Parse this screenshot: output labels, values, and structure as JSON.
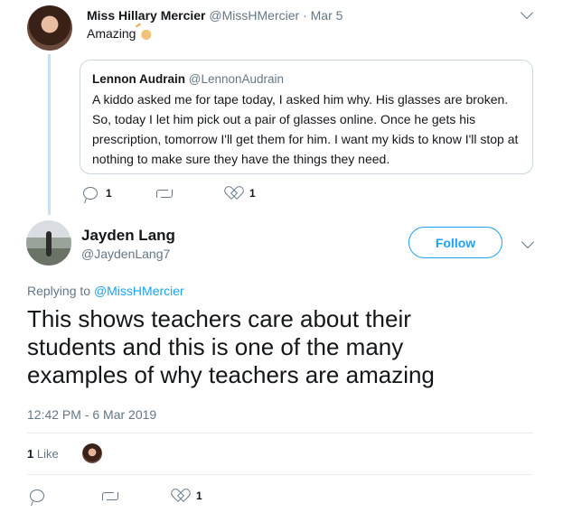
{
  "parent_tweet": {
    "name": "Miss Hillary Mercier",
    "handle": "@MissHMercier",
    "separator": "·",
    "date": "Mar 5",
    "text": "Amazing",
    "emoji_icon": "clapping-hands-icon",
    "quoted": {
      "name": "Lennon Audrain",
      "handle": "@LennonAudrain",
      "text": "A kiddo asked me for tape today, I asked him why. His glasses are broken. So, today I let him pick out a pair of glasses online. Once he gets his prescription, tomorrow I'll get them for him. I want my kids to know I'll stop at nothing to make sure they have the things they need."
    },
    "actions": {
      "reply_count": "1",
      "retweet_count": "",
      "like_count": "1"
    }
  },
  "main_tweet": {
    "name": "Jayden Lang",
    "handle": "@JaydenLang7",
    "follow_label": "Follow",
    "replying_prefix": "Replying to",
    "replying_handle": "@MissHMercier",
    "text": "This shows teachers care about their students and this is one of the many examples of why teachers are amazing",
    "timestamp": "12:42 PM - 6 Mar 2019",
    "likes_count": "1",
    "likes_label": "Like",
    "actions": {
      "reply_count": "",
      "retweet_count": "",
      "like_count": "1"
    }
  },
  "colors": {
    "accent": "#1da1f2",
    "muted": "#657786",
    "text": "#14171a",
    "thread_line": "#c4e1f6",
    "border": "#ccd6dd"
  }
}
